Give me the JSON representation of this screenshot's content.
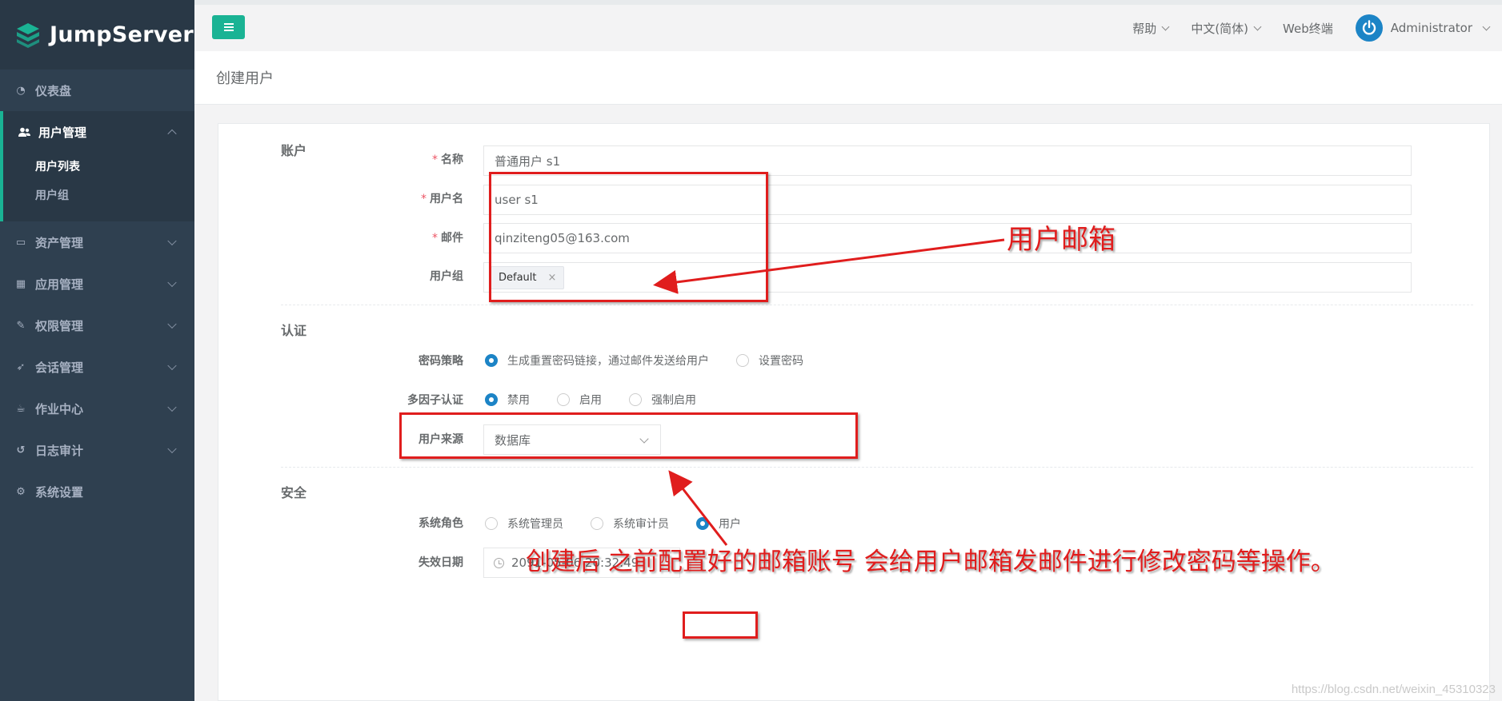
{
  "sidebar": {
    "brand": "JumpServer",
    "items": [
      {
        "label": "仪表盘"
      },
      {
        "label": "用户管理"
      },
      {
        "label": "资产管理"
      },
      {
        "label": "应用管理"
      },
      {
        "label": "权限管理"
      },
      {
        "label": "会话管理"
      },
      {
        "label": "作业中心"
      },
      {
        "label": "日志审计"
      },
      {
        "label": "系统设置"
      }
    ],
    "submenu": [
      "用户列表",
      "用户组"
    ]
  },
  "topbar": {
    "help": "帮助",
    "language": "中文(简体)",
    "web_terminal": "Web终端",
    "user": "Administrator"
  },
  "page": {
    "title": "创建用户"
  },
  "form": {
    "account_section": "账户",
    "name_label": "名称",
    "name_value": "普通用户 s1",
    "username_label": "用户名",
    "username_value": "user s1",
    "email_label": "邮件",
    "email_value": "qinziteng05@163.com",
    "group_label": "用户组",
    "group_tag": "Default",
    "auth_section": "认证",
    "password_policy_label": "密码策略",
    "password_policy_options": [
      "生成重置密码链接，通过邮件发送给用户",
      "设置密码"
    ],
    "password_policy_selected": "生成重置密码链接，通过邮件发送给用户",
    "mfa_label": "多因子认证",
    "mfa_options": [
      "禁用",
      "启用",
      "强制启用"
    ],
    "mfa_selected": "禁用",
    "source_label": "用户来源",
    "source_value": "数据库",
    "security_section": "安全",
    "role_label": "系统角色",
    "role_options": [
      "系统管理员",
      "系统审计员",
      "用户"
    ],
    "role_selected": "用户",
    "expire_label": "失效日期",
    "expire_value": "2091-05-06 20:32:49"
  },
  "annotations": {
    "email_note": "用户邮箱",
    "bottom_note": "创建后  之前配置好的邮箱账号    会给用户邮箱发邮件进行修改密码等操作。"
  },
  "watermark": "https://blog.csdn.net/weixin_45310323",
  "colors": {
    "sidebar": "#2f4050",
    "accent": "#1ab394",
    "radio_selected": "#1c84c6",
    "annotation": "#e01d1d"
  },
  "icons": [
    "jumpserver-logo",
    "dashboard-icon",
    "users-icon",
    "inbox-icon",
    "grid-icon",
    "edit-icon",
    "rocket-icon",
    "coffee-icon",
    "history-icon",
    "gears-icon",
    "menu-icon",
    "power-icon",
    "clock-icon"
  ]
}
